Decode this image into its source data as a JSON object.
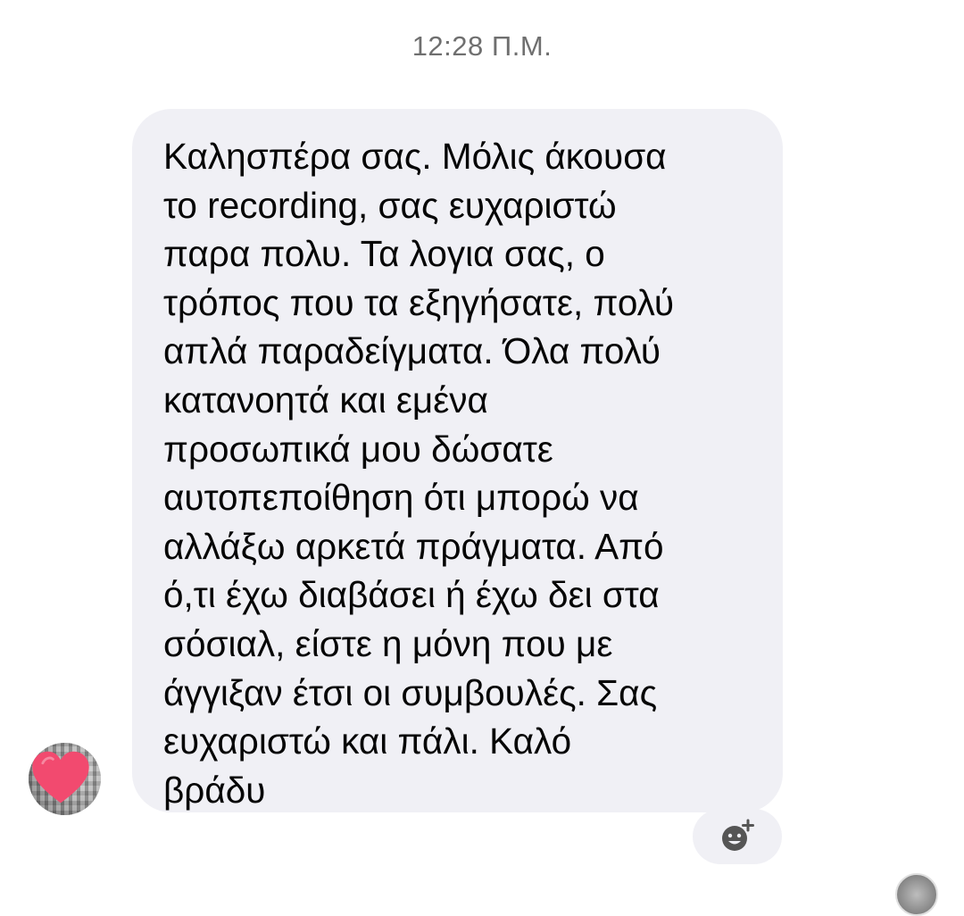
{
  "timestamp": "12:28 Π.Μ.",
  "message": {
    "text": "Καλησπέρα σας. Μόλις άκουσα\nτο recording, σας ευχαριστώ\nπαρα πολυ. Τα λογια σας, ο\nτρόπος που τα εξηγήσατε, πολύ\nαπλά παραδείγματα. Όλα πολύ\nκατανοητά και εμένα\nπροσωπικά μου δώσατε\nαυτοπεποίθηση ότι μπορώ να\nαλλάξω αρκετά πράγματα. Από\nό,τι έχω διαβάσει ή έχω δει στα\nσόσιαλ, είστε η μόνη που με\nάγγιξαν έτσι οι συμβουλές. Σας\nευχαριστώ και πάλι. Καλό\nβράδυ",
    "bubble_color": "#f0f0f5",
    "text_color": "#050505"
  },
  "sender": {
    "avatar_icon": "heart-icon",
    "heart_color": "#f24a6f"
  },
  "reaction": {
    "icon": "add-reaction-icon"
  },
  "colors": {
    "timestamp": "#6f6f6f",
    "background": "#ffffff"
  }
}
